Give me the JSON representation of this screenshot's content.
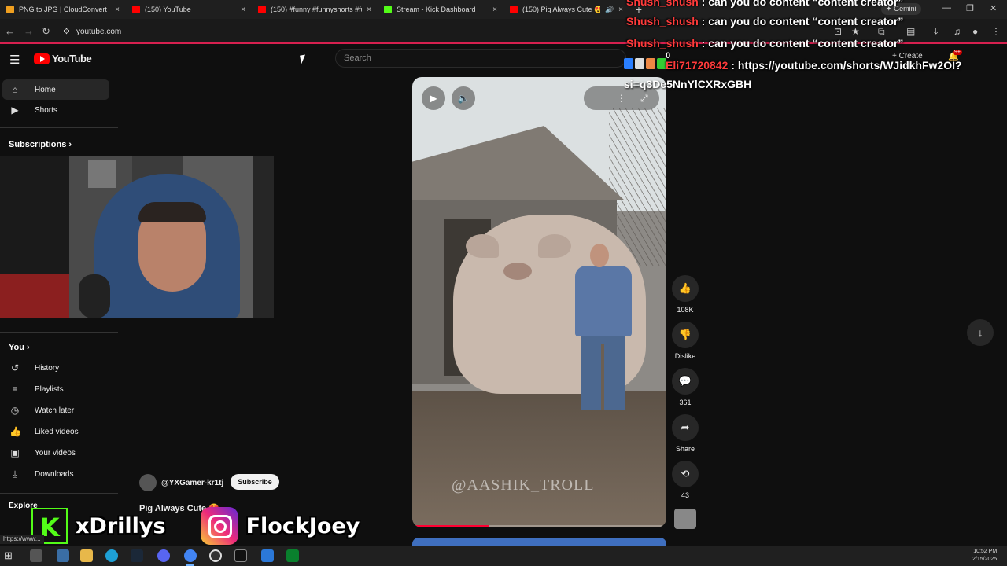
{
  "browser": {
    "tabs": [
      {
        "title": "PNG to JPG | CloudConvert",
        "color": "#f0a020"
      },
      {
        "title": "(150) YouTube",
        "color": "#ff0000"
      },
      {
        "title": "(150) #funny #funnyshorts #fu",
        "color": "#ff0000"
      },
      {
        "title": "Stream - Kick Dashboard",
        "color": "#53fc18"
      },
      {
        "title": "(150) Pig Always Cute 😍",
        "color": "#ff0000"
      }
    ],
    "close_glyph": "×",
    "new_tab_glyph": "+",
    "gemini_label": "Gemini",
    "url": "youtube.com"
  },
  "youtube": {
    "logo_text": "YouTube",
    "search_placeholder": "Search",
    "create_label": "Create",
    "notif_badge": "9+"
  },
  "sidebar": {
    "top_items": [
      {
        "label": "Home",
        "icon": "home-icon"
      },
      {
        "label": "Shorts",
        "icon": "shorts-icon"
      }
    ],
    "subscriptions_label": "Subscriptions",
    "you_label": "You",
    "you_items": [
      {
        "label": "History",
        "icon": "history-icon"
      },
      {
        "label": "Playlists",
        "icon": "playlists-icon"
      },
      {
        "label": "Watch later",
        "icon": "watch-later-icon"
      },
      {
        "label": "Liked videos",
        "icon": "liked-videos-icon"
      },
      {
        "label": "Your videos",
        "icon": "your-videos-icon"
      },
      {
        "label": "Downloads",
        "icon": "downloads-icon"
      }
    ],
    "explore_label": "Explore"
  },
  "short": {
    "channel_handle": "@YXGamer-kr1tj",
    "subscribe_label": "Subscribe",
    "title": "Pig Always Cute 😍",
    "watermark": "@AASHIK_TROLL",
    "progress": 0.3
  },
  "actions": {
    "likes": "108K",
    "dislike_label": "Dislike",
    "comments": "361",
    "share_label": "Share",
    "remix_count": "43"
  },
  "chat": {
    "messages": [
      {
        "user": "Shush_shush",
        "text": "can you do content “content creator”"
      },
      {
        "user": "Shush_shush",
        "text": "can you do content “content creator”"
      },
      {
        "user": "Shush_shush",
        "text": "can you do content “content creator”"
      },
      {
        "user": "Eli71720842",
        "text": "https://youtube.com/shorts/WJidkhFw2OI?"
      }
    ],
    "continuation": "si=q3De5NnYlCXRxGBH",
    "emote_count": "0"
  },
  "overlay": {
    "kick_handle": "xDrillys",
    "instagram_handle": "FlockJoey"
  },
  "status_url": "https://www...",
  "taskbar": {
    "time": "10:52 PM",
    "date": "2/15/2025"
  }
}
